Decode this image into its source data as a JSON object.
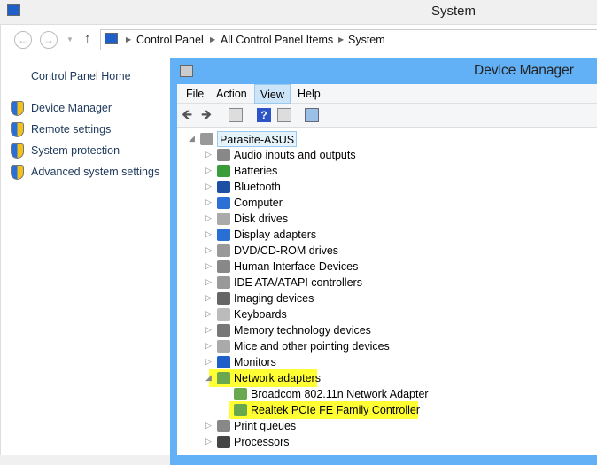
{
  "system_window": {
    "title": "System",
    "breadcrumbs": [
      "Control Panel",
      "All Control Panel Items",
      "System"
    ],
    "left_nav": {
      "home": "Control Panel Home",
      "links": [
        "Device Manager",
        "Remote settings",
        "System protection",
        "Advanced system settings"
      ]
    }
  },
  "device_manager": {
    "title": "Device Manager",
    "menu": [
      "File",
      "Action",
      "View",
      "Help"
    ],
    "root": "Parasite-ASUS",
    "categories": [
      "Audio inputs and outputs",
      "Batteries",
      "Bluetooth",
      "Computer",
      "Disk drives",
      "Display adapters",
      "DVD/CD-ROM drives",
      "Human Interface Devices",
      "IDE ATA/ATAPI controllers",
      "Imaging devices",
      "Keyboards",
      "Memory technology devices",
      "Mice and other pointing devices",
      "Monitors",
      "Network adapters",
      "Print queues",
      "Processors"
    ],
    "network_children": [
      "Broadcom 802.11n Network Adapter",
      "Realtek PCIe FE Family Controller"
    ],
    "highlight_color": "#ffff33"
  }
}
